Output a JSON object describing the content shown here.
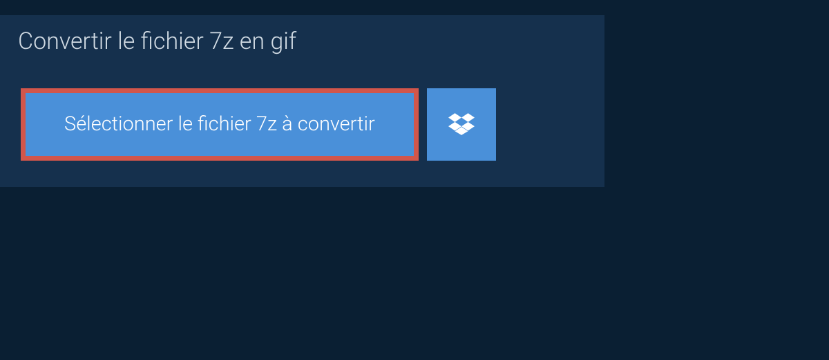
{
  "header": {
    "title": "Convertir le fichier 7z en gif"
  },
  "actions": {
    "select_file_label": "Sélectionner le fichier 7z à convertir"
  }
}
